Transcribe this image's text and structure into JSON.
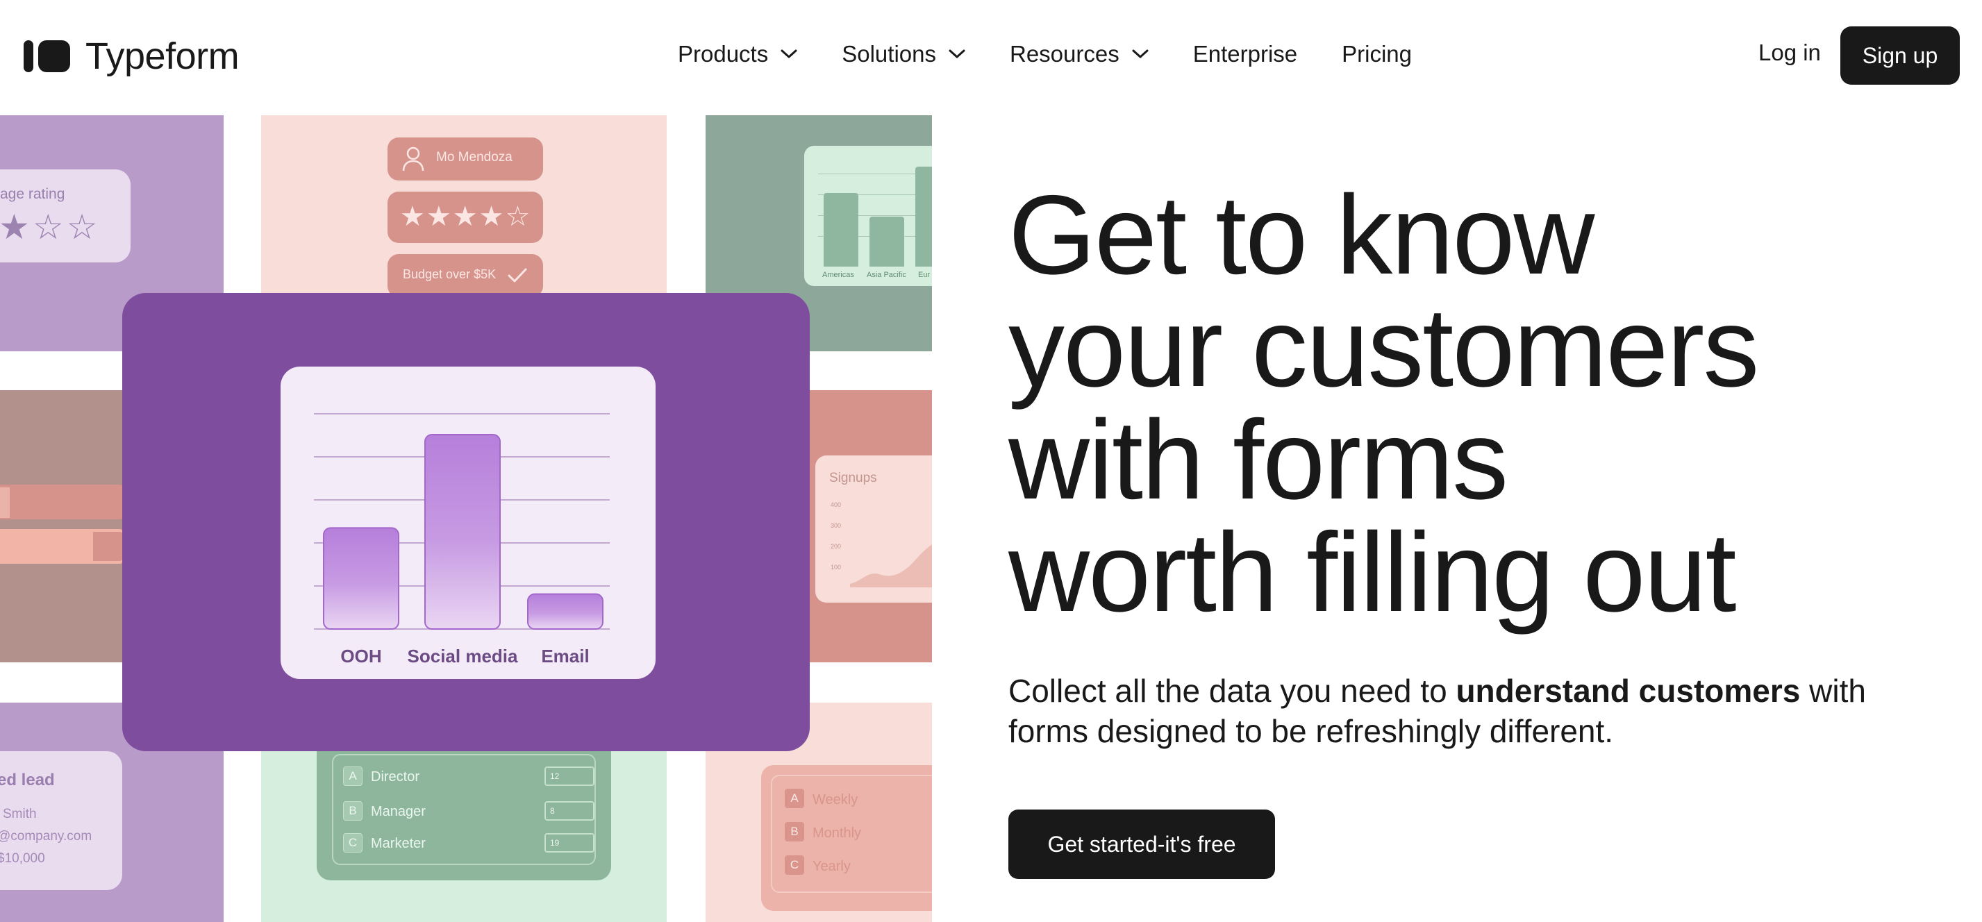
{
  "brand": {
    "name": "Typeform"
  },
  "nav": {
    "items": [
      {
        "label": "Products",
        "has_dropdown": true
      },
      {
        "label": "Solutions",
        "has_dropdown": true
      },
      {
        "label": "Resources",
        "has_dropdown": true
      },
      {
        "label": "Enterprise",
        "has_dropdown": false
      },
      {
        "label": "Pricing",
        "has_dropdown": false
      }
    ],
    "login_label": "Log in",
    "signup_label": "Sign up"
  },
  "hero": {
    "headline_lines": [
      "Get to know",
      "your customers",
      "with forms",
      "worth filling out"
    ],
    "subhead_prefix": "Collect all the data you need to ",
    "subhead_bold": "understand customers",
    "subhead_suffix": " with forms designed to be refreshingly different.",
    "cta_label": "Get started-it's free"
  },
  "collage": {
    "rating_card": {
      "label": "age rating",
      "stars_filled": 1,
      "stars_total": 3
    },
    "profile_pill": {
      "name": "Mo Mendoza"
    },
    "stars_pill": {
      "stars_filled": 4,
      "stars_total": 5
    },
    "budget_pill": {
      "label": "Budget over $5K"
    },
    "region_chart": {
      "labels": [
        "Americas",
        "Asia Pacific",
        "Eur"
      ]
    },
    "featured_chart": {
      "categories": [
        "OOH",
        "Social media",
        "Email"
      ],
      "values": [
        0.52,
        1.0,
        0.18
      ]
    },
    "signups_card": {
      "title": "Signups",
      "ticks": [
        "400",
        "300",
        "200",
        "100"
      ]
    },
    "lead_card": {
      "title": "ed lead",
      "lines": [
        "Smith",
        "@company.com",
        "$10,000"
      ]
    },
    "role_list": {
      "options": [
        {
          "key": "A",
          "label": "Director",
          "value": "12"
        },
        {
          "key": "B",
          "label": "Manager",
          "value": "8"
        },
        {
          "key": "C",
          "label": "Marketer",
          "value": "19"
        }
      ]
    },
    "frequency_list": {
      "options": [
        {
          "key": "A",
          "label": "Weekly"
        },
        {
          "key": "B",
          "label": "Monthly"
        },
        {
          "key": "C",
          "label": "Yearly"
        }
      ]
    }
  },
  "colors": {
    "ink": "#191919",
    "featured_purple": "#7f4d9e",
    "bar_purple": "#b67fdb",
    "lavender_tile": "#b99bc9",
    "peach_tile": "#f8ddd9",
    "sage_tile": "#8da89a",
    "rose_tile": "#d6938c",
    "mint_tile": "#d6eedd"
  }
}
